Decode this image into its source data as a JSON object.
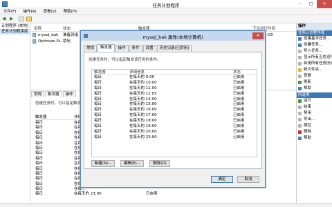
{
  "window": {
    "title": "任务计划程序"
  },
  "menu": [
    "文件(F)",
    "操作(A)",
    "查看(V)",
    "帮助(H)"
  ],
  "tree": {
    "items": [
      {
        "label": "计划程序 (本地)",
        "selected": false
      },
      {
        "label": "任务计划程序库",
        "selected": true
      }
    ]
  },
  "task_list": {
    "columns": [
      "名称",
      "状态",
      "触发器",
      "下次运行时间"
    ],
    "rows": [
      {
        "name": "mysql_bak",
        "status": "准备就绪",
        "trigger": "",
        "next": "12:05:00"
      },
      {
        "name": "Optimize St...",
        "status": "禁用",
        "trigger": "",
        "next": ""
      }
    ]
  },
  "bottom": {
    "tabs": [
      "常规",
      "触发器",
      "操作"
    ],
    "active_tab": "触发器",
    "description": "创建任务时，可以指定触发该任务的条件。",
    "columns": [
      "触发器",
      "详细信息",
      "状态"
    ],
    "rows": [
      {
        "trigger": "每日",
        "detail": "在每...",
        "status": ""
      },
      {
        "trigger": "每日",
        "detail": "在每...",
        "status": ""
      },
      {
        "trigger": "每日",
        "detail": "在每...",
        "status": ""
      },
      {
        "trigger": "每日",
        "detail": "在每...",
        "status": ""
      },
      {
        "trigger": "每日",
        "detail": "在每...",
        "status": ""
      },
      {
        "trigger": "每日",
        "detail": "在每...",
        "status": ""
      },
      {
        "trigger": "每日",
        "detail": "在每...",
        "status": ""
      },
      {
        "trigger": "每日",
        "detail": "在每...",
        "status": ""
      },
      {
        "trigger": "每日",
        "detail": "在每...",
        "status": ""
      },
      {
        "trigger": "每日",
        "detail": "在每...",
        "status": ""
      },
      {
        "trigger": "每日",
        "detail": "在每...",
        "status": ""
      },
      {
        "trigger": "每日",
        "detail": "在每...",
        "status": ""
      },
      {
        "trigger": "每日",
        "detail": "在每...",
        "status": ""
      },
      {
        "trigger": "每日",
        "detail": "在每...",
        "status": ""
      },
      {
        "trigger": "每日",
        "detail": "在每天的 23:00",
        "status": "已启用"
      }
    ]
  },
  "actions": {
    "header": "操作",
    "section1": "任务计划程序库",
    "items1": [
      {
        "label": "创建基本任务...",
        "icon": "basic-task-icon",
        "color": "blue"
      },
      {
        "label": "创建任务...",
        "icon": "create-task-icon",
        "color": "blue"
      },
      {
        "label": "导入任务...",
        "icon": "import-icon",
        "color": "gray"
      },
      {
        "label": "显示所有正在运行...",
        "icon": "running-icon",
        "color": "gray"
      },
      {
        "label": "启用所有任务历史...",
        "icon": "history-icon",
        "color": "gray"
      },
      {
        "label": "新文件夹...",
        "icon": "folder-icon",
        "color": "yellow"
      },
      {
        "label": "查看",
        "icon": "view-icon",
        "color": "gray"
      },
      {
        "label": "刷新",
        "icon": "refresh-icon",
        "color": "green"
      },
      {
        "label": "帮助",
        "icon": "help-icon",
        "color": "blue"
      }
    ],
    "section2": "所选项",
    "items2": [
      {
        "label": "运行",
        "icon": "run-icon",
        "color": "green"
      },
      {
        "label": "结束",
        "icon": "end-icon",
        "color": "gray"
      },
      {
        "label": "禁用",
        "icon": "disable-icon",
        "color": "gray"
      },
      {
        "label": "导出...",
        "icon": "export-icon",
        "color": "gray"
      },
      {
        "label": "属性",
        "icon": "properties-icon",
        "color": "gray"
      },
      {
        "label": "删除",
        "icon": "delete-icon",
        "color": "red"
      },
      {
        "label": "帮助",
        "icon": "help-icon",
        "color": "blue"
      }
    ]
  },
  "dialog": {
    "title": "mysql_bak 属性(本地计算机)",
    "close_glyph": "✕",
    "tabs": [
      "常规",
      "触发器",
      "操作",
      "条件",
      "设置",
      "历史记录(已禁用)"
    ],
    "active_tab": "触发器",
    "description": "创建任务时，可以指定触发该任务的条件。",
    "columns": [
      "触发器",
      "详细信息",
      "状态"
    ],
    "rows": [
      {
        "trigger": "每日",
        "detail": "在每天的 9:00",
        "status": "已启用"
      },
      {
        "trigger": "每日",
        "detail": "在每天的 10:00",
        "status": "已启用"
      },
      {
        "trigger": "每日",
        "detail": "在每天的 11:00",
        "status": "已启用"
      },
      {
        "trigger": "每日",
        "detail": "在每天的 12:05",
        "status": "已启用"
      },
      {
        "trigger": "每日",
        "detail": "在每天的 14:00",
        "status": "已启用"
      },
      {
        "trigger": "每日",
        "detail": "在每天的 15:00",
        "status": "已启用"
      },
      {
        "trigger": "每日",
        "detail": "在每天的 16:00",
        "status": "已启用"
      },
      {
        "trigger": "每日",
        "detail": "在每天的 17:00",
        "status": "已启用"
      },
      {
        "trigger": "每日",
        "detail": "在每天的 18:00",
        "status": "已启用"
      },
      {
        "trigger": "每日",
        "detail": "在每天的 19:00",
        "status": "已启用"
      },
      {
        "trigger": "每日",
        "detail": "在每天的 20:00",
        "status": "已启用"
      },
      {
        "trigger": "每日",
        "detail": "在每天的 23:00",
        "status": "已启用"
      }
    ],
    "buttons": {
      "new": "新建(N)...",
      "edit": "编辑(E)...",
      "delete": "删除(D)",
      "ok": "确定",
      "cancel": "取消"
    }
  },
  "colors": {
    "accent": "#3c78b4",
    "selected": "#cce4f7",
    "close": "#c7504a"
  }
}
